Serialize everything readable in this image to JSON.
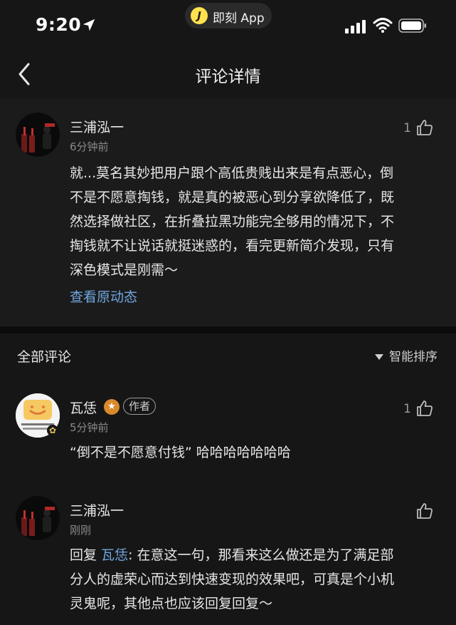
{
  "status_bar": {
    "time": "9:20",
    "app_pill_logo": "J",
    "app_pill_label": "即刻 App",
    "icons": [
      "location-arrow-icon",
      "signal-icon",
      "wifi-icon",
      "battery-icon"
    ]
  },
  "nav": {
    "title": "评论详情",
    "back_icon": "chevron-left-icon"
  },
  "main_comment": {
    "username": "三浦泓一",
    "time": "6分钟前",
    "like_count": "1",
    "lines": [
      "就...莫名其妙把用户跟个高低贵贱出来是有点恶心，倒",
      "不是不愿意掏钱，就是真的被恶心到分享欲降低了，既",
      "然选择做社区，在折叠拉黑功能完全够用的情况下，不",
      "掏钱就不让说话就挺迷惑的，看完更新简介发现，只有",
      "深色模式是刚需～"
    ],
    "view_original": "查看原动态"
  },
  "comments_section": {
    "title": "全部评论",
    "sort_label": "智能排序"
  },
  "comments": [
    {
      "username": "瓦恁",
      "author_tag": "作者",
      "time": "5分钟前",
      "like_count": "1",
      "text": "“倒不是不愿意付钱” 哈哈哈哈哈哈哈"
    },
    {
      "username": "三浦泓一",
      "time": "刚刚",
      "like_count": "",
      "reply_prefix": "回复 ",
      "reply_to": "瓦恁",
      "lines": [
        ": 在意这一句，那看来这么做还是为了满足部",
        "分人的虚荣心而达到快速变现的效果吧，可真是个小机",
        "灵鬼呢，其他点也应该回复回复～"
      ]
    }
  ],
  "colors": {
    "background": "#161616",
    "card": "#1b1b1b",
    "link": "#6fa6e0",
    "medal": "#d98a2b",
    "app_logo": "#ffe14d"
  }
}
